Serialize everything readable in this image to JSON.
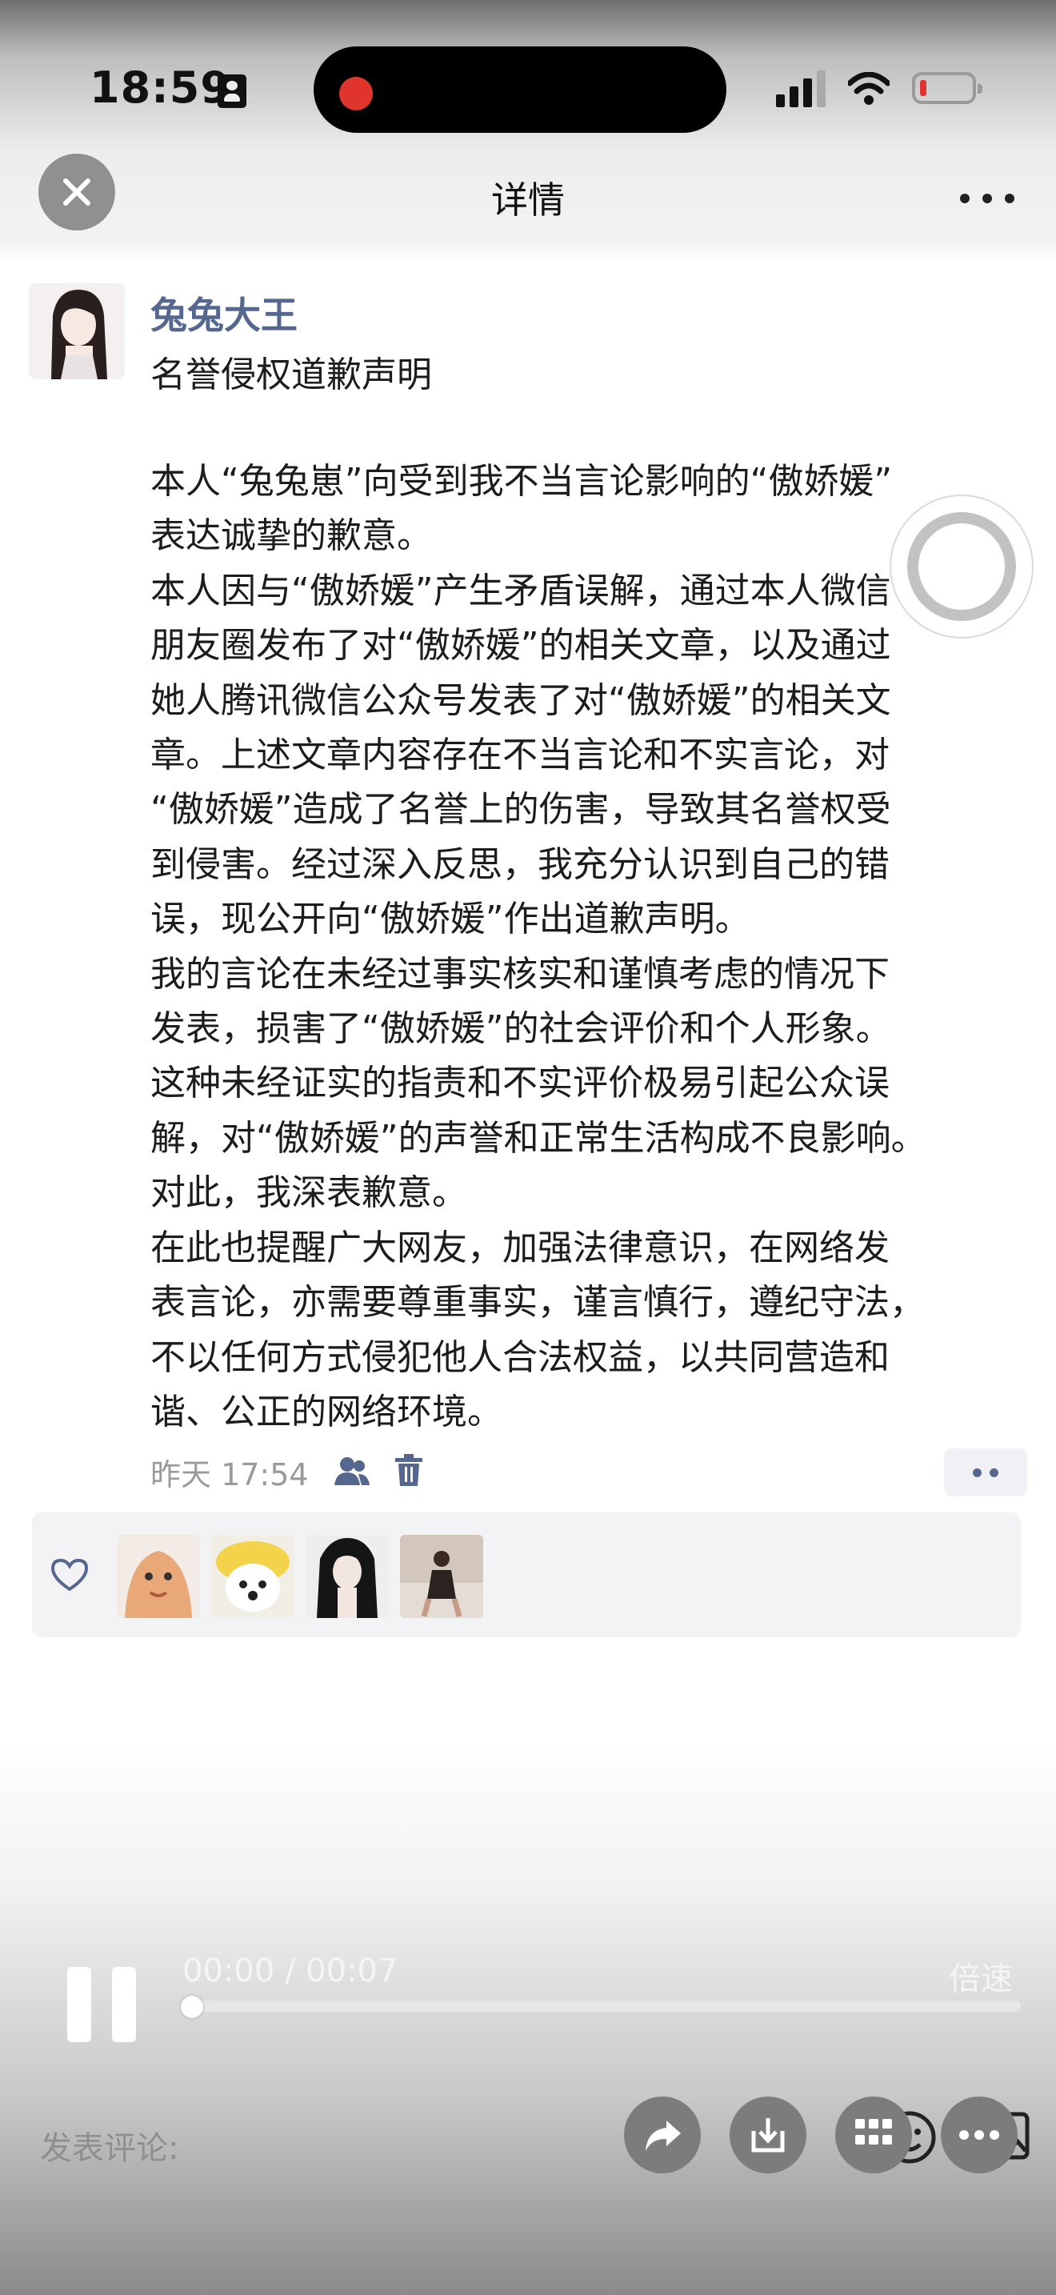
{
  "status_bar": {
    "time": "18:59"
  },
  "nav": {
    "title": "详情"
  },
  "post": {
    "username": "兔兔大王",
    "title": "名誉侵权道歉声明",
    "body_lines": [
      "本人“兔兔崽”向受到我不当言论影响的“傲娇媛”",
      "表达诚挚的歉意。",
      "本人因与“傲娇媛”产生矛盾误解，通过本人微信",
      "朋友圈发布了对“傲娇媛”的相关文章，以及通过",
      "她人腾讯微信公众号发表了对“傲娇媛”的相关文",
      "章。上述文章内容存在不当言论和不实言论，对",
      "“傲娇媛”造成了名誉上的伤害，导致其名誉权受",
      "到侵害。经过深入反思，我充分认识到自己的错",
      "误，现公开向“傲娇媛”作出道歉声明。",
      "我的言论在未经过事实核实和谨慎考虑的情况下",
      "发表，损害了“傲娇媛”的社会评价和个人形象。",
      "这种未经证实的指责和不实评价极易引起公众误",
      "解，对“傲娇媛”的声誉和正常生活构成不良影响。",
      "对此，我深表歉意。",
      "在此也提醒广大网友，加强法律意识，在网络发",
      "表言论，亦需要尊重事实，谨言慎行，遵纪守法，",
      "不以任何方式侵犯他人合法权益，以共同营造和",
      "谐、公正的网络环境。"
    ],
    "timestamp": "昨天 17:54"
  },
  "video": {
    "time": "00:00 / 00:07",
    "speed_label": "倍速",
    "progress": 0.0
  },
  "comment": {
    "placeholder": "发表评论:"
  },
  "icons": [
    "close-icon",
    "more-icon",
    "friends-icon",
    "trash-icon",
    "heart-icon",
    "pause-icon",
    "share-icon",
    "download-icon",
    "grid-icon",
    "more-circle-icon",
    "emoji-icon",
    "image-icon"
  ],
  "colors": {
    "username": "#56678f",
    "record": "#e0352c"
  }
}
